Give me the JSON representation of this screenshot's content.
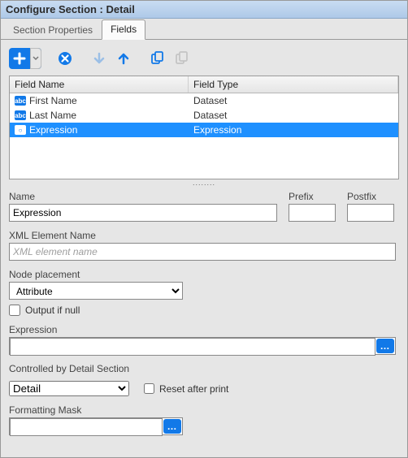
{
  "title": "Configure Section : Detail",
  "tabs": {
    "props": "Section Properties",
    "fields": "Fields",
    "active": "fields"
  },
  "table": {
    "headers": {
      "name": "Field Name",
      "type": "Field Type"
    },
    "rows": [
      {
        "icon": "abc",
        "name": "First Name",
        "type": "Dataset",
        "selected": false
      },
      {
        "icon": "abc",
        "name": "Last Name",
        "type": "Dataset",
        "selected": false
      },
      {
        "icon": "expr",
        "name": "Expression",
        "type": "Expression",
        "selected": true
      }
    ]
  },
  "form": {
    "name_label": "Name",
    "name_value": "Expression",
    "prefix_label": "Prefix",
    "prefix_value": "",
    "postfix_label": "Postfix",
    "postfix_value": "",
    "xml_label": "XML Element Name",
    "xml_placeholder": "XML element name",
    "xml_value": "",
    "nodeplacement_label": "Node placement",
    "nodeplacement_value": "Attribute",
    "output_if_null_label": "Output if null",
    "expression_label": "Expression",
    "expression_value": "",
    "controlled_by_label": "Controlled by Detail Section",
    "controlled_by_value": "Detail",
    "reset_after_print_label": "Reset after print",
    "formatting_mask_label": "Formatting Mask",
    "formatting_mask_value": ""
  },
  "icons": {
    "abc_text": "abc",
    "expr_text": "○"
  }
}
